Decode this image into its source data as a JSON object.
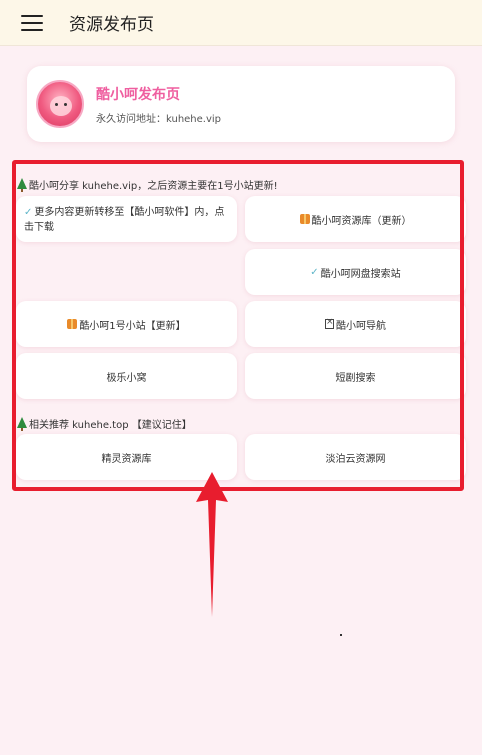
{
  "header": {
    "title": "资源发布页",
    "menu_icon": "hamburger-menu-icon"
  },
  "profile": {
    "name": "酷小呵发布页",
    "url_text": "永久访问地址：kuhehe.vip"
  },
  "section1": {
    "heading": "酷小呵分享 kuhehe.vip，之后资源主要在1号小站更新!",
    "tiles": [
      {
        "text": "更多内容更新转移至【酷小呵软件】内，点击下载",
        "icon": "check-icon"
      },
      {
        "text": "酷小呵资源库（更新）",
        "icon": "gift-icon"
      },
      {
        "text": "酷小呵网盘搜索站",
        "icon": "check-icon"
      },
      {
        "text": "酷小呵1号小站【更新】",
        "icon": "gift-icon"
      },
      {
        "text": "酷小呵导航",
        "icon": "box-icon"
      },
      {
        "text": "极乐小窝"
      },
      {
        "text": "短剧搜索"
      }
    ]
  },
  "section2": {
    "heading": "相关推荐 kuhehe.top 【建议记住】",
    "tiles": [
      {
        "text": "精灵资源库"
      },
      {
        "text": "淡泊云资源网"
      }
    ]
  },
  "colors": {
    "accent": "#ef5fa0",
    "highlight": "#e81d2e",
    "background": "#fdf0f4",
    "topbar": "#fdf7e8"
  }
}
